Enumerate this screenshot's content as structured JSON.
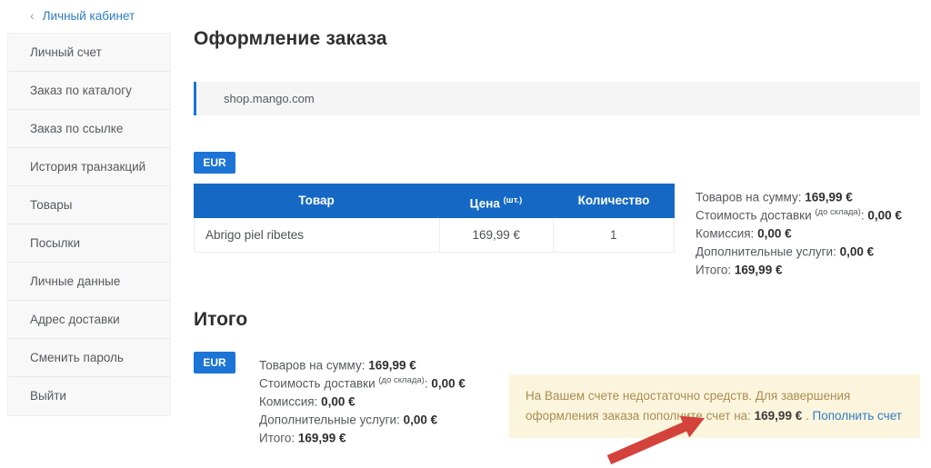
{
  "back_link": {
    "chevron": "‹",
    "label": "Личный кабинет"
  },
  "sidebar": {
    "items": [
      "Личный счет",
      "Заказ по каталогу",
      "Заказ по ссылке",
      "История транзакций",
      "Товары",
      "Посылки",
      "Личные данные",
      "Адрес доставки",
      "Сменить пароль",
      "Выйти"
    ]
  },
  "main": {
    "title": "Оформление заказа",
    "shop_name": "shop.mango.com",
    "currency": "EUR",
    "total_title": "Итого",
    "table": {
      "header_product": "Товар",
      "header_price": "Цена ",
      "header_price_sup": "(шт.)",
      "header_qty": "Количество",
      "rows": [
        {
          "product": "Abrigo piel ribetes",
          "price": "169,99 €",
          "qty": "1"
        }
      ]
    }
  },
  "summary": {
    "items": [
      {
        "label": "Товаров на сумму",
        "sup": "",
        "sep": ": ",
        "value": "169,99 €"
      },
      {
        "label": "Стоимость доставки ",
        "sup": "(до склада)",
        "sep": ": ",
        "value": "0,00 €"
      },
      {
        "label": "Комиссия",
        "sup": "",
        "sep": ": ",
        "value": "0,00 €"
      },
      {
        "label": "Дополнительные услуги",
        "sup": "",
        "sep": ": ",
        "value": "0,00 €"
      },
      {
        "label": "Итого",
        "sup": "",
        "sep": ": ",
        "value": "169,99 €"
      }
    ]
  },
  "warning": {
    "text": "На Вашем счете недостаточно средств. Для завершения оформления заказа пополните счет на: ",
    "amount": "169,99 €",
    "sep": " . ",
    "link": "Пополнить счет"
  },
  "colors": {
    "accent-blue": "#1b74d6",
    "table-header-blue": "#1568c4",
    "link-blue": "#2e7cc4",
    "sidebar-bg": "#f8f8f8",
    "bar-bg": "#f5f5f5",
    "warning-bg": "#fcf5dd",
    "warning-text": "#a98d52",
    "arrow-red": "#d4423c",
    "text-dark": "#2f2f2f",
    "text-gray": "#55595f"
  }
}
